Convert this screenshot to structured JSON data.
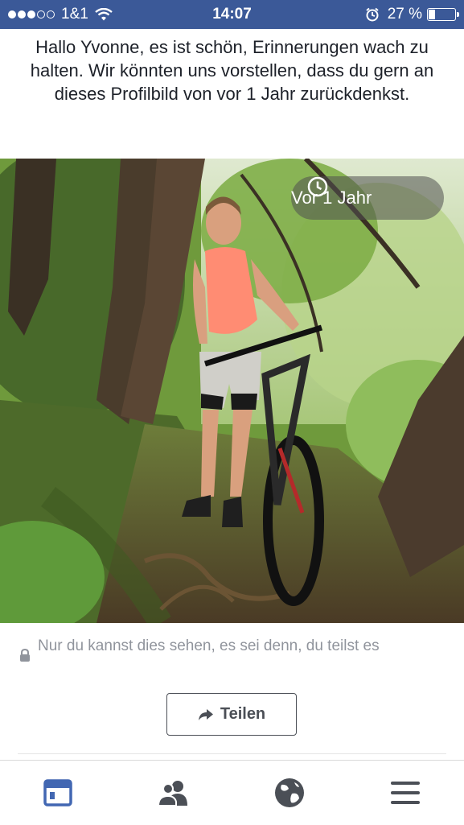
{
  "status_bar": {
    "carrier": "1&1",
    "time": "14:07",
    "battery": "27 %",
    "battery_level": 0.27,
    "signal_bars_filled": 3,
    "signal_bars_total": 5,
    "icons": [
      "wifi-icon",
      "alarm-icon",
      "battery-icon"
    ]
  },
  "memory": {
    "message": "Hallo Yvonne, es ist schön, Erinnerungen wach zu halten. Wir könnten uns vorstellen, dass du gern an dieses Profilbild von vor 1 Jahr zurückdenkst.",
    "time_badge": "Vor 1 Jahr",
    "privacy_note": "Nur du kannst dies sehen, es sei denn, du teilst es",
    "share_label": "Teilen"
  },
  "tab_bar": {
    "tabs": [
      {
        "icon": "news-feed-icon",
        "active": true
      },
      {
        "icon": "friends-icon",
        "active": false
      },
      {
        "icon": "globe-icon",
        "active": false
      },
      {
        "icon": "menu-icon",
        "active": false
      }
    ]
  },
  "colors": {
    "brand": "#3b5998",
    "text": "#1d2129",
    "muted": "#90949c",
    "active_tab": "#4267b2",
    "inactive_tab": "#4b4f56"
  }
}
